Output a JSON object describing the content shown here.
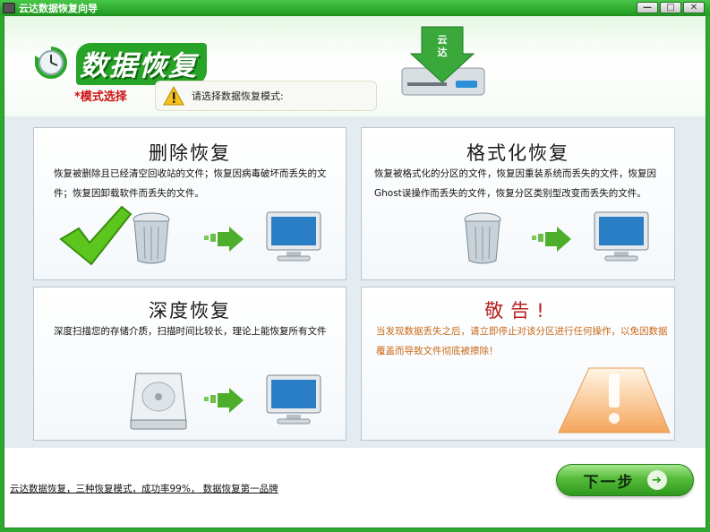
{
  "window": {
    "title": "云达数据恢复向导",
    "minimize_glyph": "—",
    "maximize_glyph": "□",
    "close_glyph": "✕"
  },
  "header": {
    "app_heading": "数据恢复",
    "mode_label": "*模式选择",
    "hint_text": "请选择数据恢复模式:",
    "logo_text": "云达"
  },
  "cards": {
    "delete": {
      "title": "删除恢复",
      "description": "恢复被删除且已经清空回收站的文件；恢复因病毒破坏而丢失的文件；恢复因卸载软件而丢失的文件。",
      "icons": [
        "checkmark-icon",
        "recycle-bin-icon",
        "arrow-icon",
        "monitor-icon"
      ]
    },
    "format": {
      "title": "格式化恢复",
      "description": "恢复被格式化的分区的文件，恢复因重装系统而丢失的文件，恢复因Ghost误操作而丢失的文件，恢复分区类别型改变而丢失的文件。",
      "icons": [
        "recycle-bin-icon",
        "arrow-icon",
        "monitor-icon"
      ]
    },
    "deep": {
      "title": "深度恢复",
      "description": "深度扫描您的存储介质，扫描时间比较长，理论上能恢复所有文件",
      "icons": [
        "hard-drive-icon",
        "arrow-icon",
        "monitor-icon"
      ]
    },
    "warning": {
      "title": "敬告!",
      "description": "当发现数据丢失之后，请立即停止对该分区进行任何操作，以免因数据覆盖而导致文件彻底被擦除！",
      "icons": [
        "exclamation-icon"
      ]
    }
  },
  "footer": {
    "link_text": "云达数据恢复，三种恢复模式，成功率99%， 数据恢复第一品牌",
    "next_button_label": "下一步",
    "next_arrow": "➔"
  },
  "colors": {
    "window_green": "#2ea82e",
    "mode_label_red": "#cc1111",
    "warning_title": "#b82020",
    "warning_text": "#c86a1a",
    "button_green": "#56bb3a"
  }
}
